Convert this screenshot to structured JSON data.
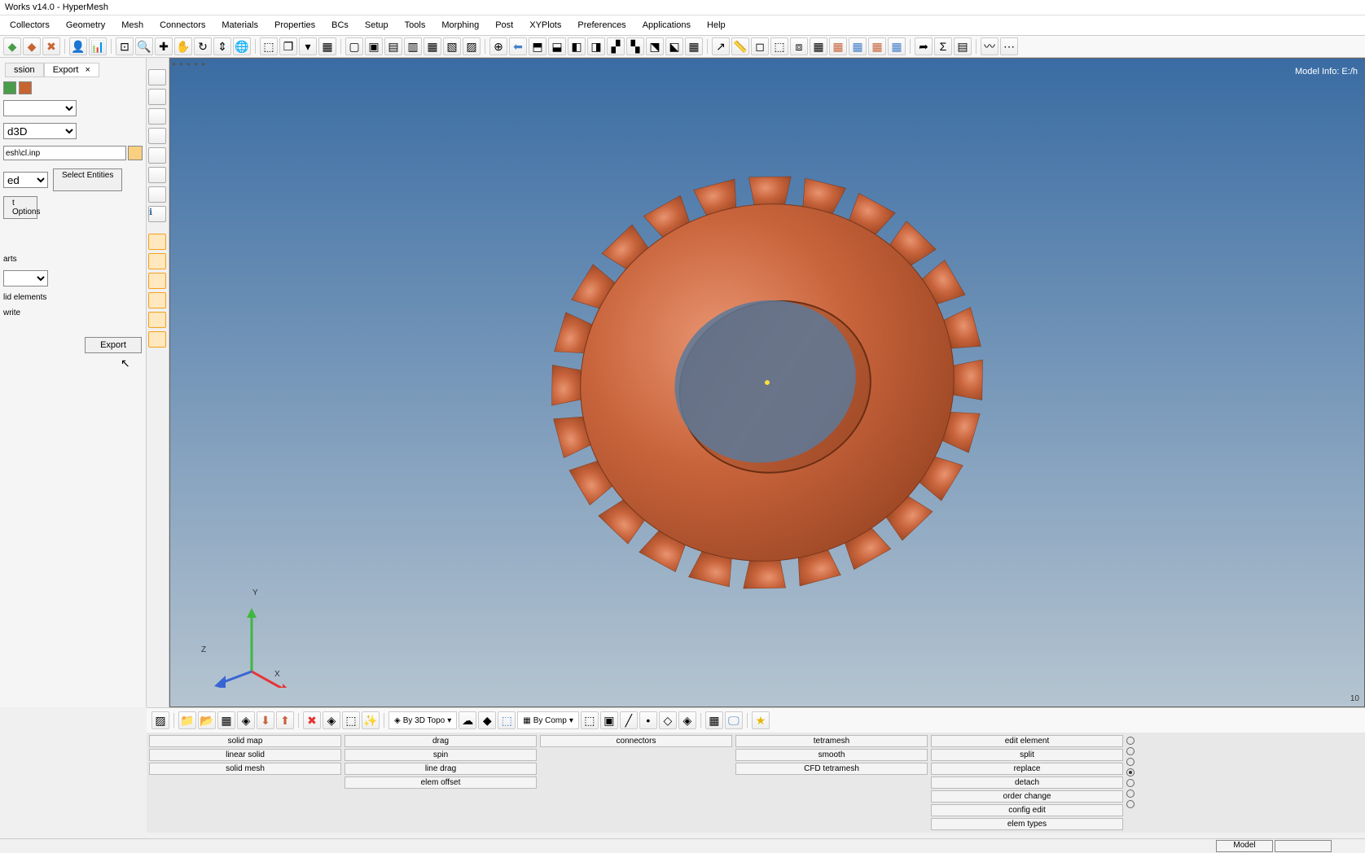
{
  "window": {
    "title": "Works v14.0 - HyperMesh"
  },
  "menu": {
    "collectors": "Collectors",
    "geometry": "Geometry",
    "mesh": "Mesh",
    "connectors": "Connectors",
    "materials": "Materials",
    "properties": "Properties",
    "bcs": "BCs",
    "setup": "Setup",
    "tools": "Tools",
    "morphing": "Morphing",
    "post": "Post",
    "xyplots": "XYPlots",
    "preferences": "Preferences",
    "applications": "Applications",
    "help": "Help"
  },
  "left_panel": {
    "tabs": {
      "session": "ssion",
      "export": "Export"
    },
    "file_value": "esh\\cl.inp",
    "dropdown2_value": "d3D",
    "combo_value": "ed",
    "select_entities": "Select Entities",
    "options": "t Options",
    "label_parts": "arts",
    "label_elements": "lid elements",
    "label_write": "write",
    "export": "Export"
  },
  "viewport": {
    "model_info": "Model Info: E:/h",
    "axis_y": "Y",
    "axis_x": "X",
    "axis_z": "Z",
    "bottom_value": "10"
  },
  "bottom_toolbar": {
    "by_3d_topo": "By 3D Topo",
    "by_comp": "By Comp"
  },
  "panel_grid": {
    "col1": {
      "solid_map": "solid map",
      "linear_solid": "linear solid",
      "solid_mesh": "solid mesh"
    },
    "col2": {
      "drag": "drag",
      "spin": "spin",
      "line_drag": "line drag",
      "elem_offset": "elem offset"
    },
    "col3": {
      "connectors": "connectors"
    },
    "col4": {
      "tetramesh": "tetramesh",
      "smooth": "smooth",
      "cfd_tetramesh": "CFD tetramesh"
    },
    "col5": {
      "edit_element": "edit element",
      "split": "split",
      "replace": "replace",
      "detach": "detach",
      "order_change": "order change",
      "config_edit": "config edit",
      "elem_types": "elem types"
    }
  },
  "status": {
    "model": "Model"
  }
}
